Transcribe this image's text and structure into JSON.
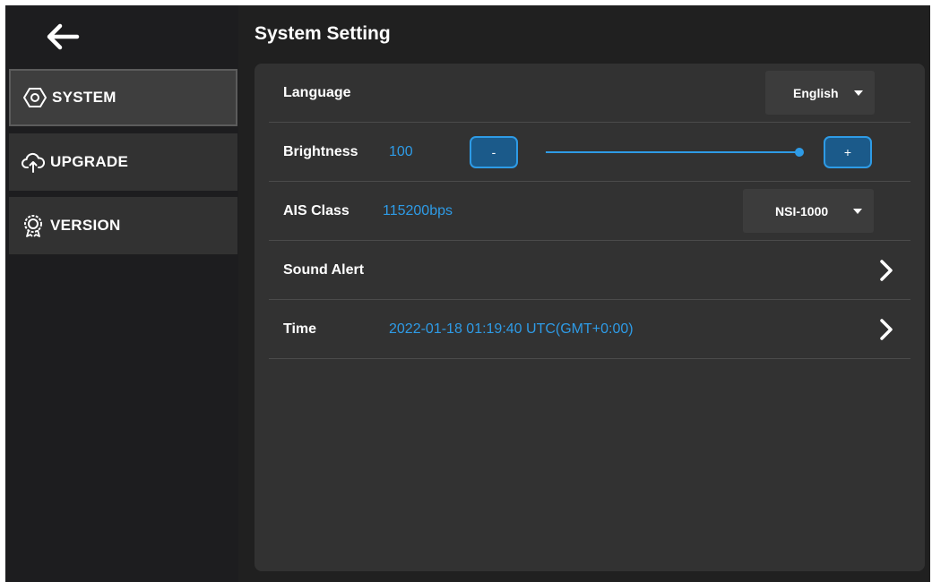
{
  "sidebar": {
    "items": [
      {
        "label": "SYSTEM",
        "icon": "hexagon-nut-icon",
        "active": true
      },
      {
        "label": "UPGRADE",
        "icon": "cloud-upload-icon",
        "active": false
      },
      {
        "label": "VERSION",
        "icon": "badge-ribbon-icon",
        "active": false
      }
    ]
  },
  "header": {
    "title": "System Setting",
    "back_icon": "back-arrow-icon"
  },
  "settings": {
    "language": {
      "label": "Language",
      "value": "English"
    },
    "brightness": {
      "label": "Brightness",
      "value": "100",
      "level": 1.0,
      "minus_label": "-",
      "plus_label": "+"
    },
    "ais_class": {
      "label": "AIS Class",
      "rate": "115200bps",
      "value": "NSI-1000"
    },
    "sound_alert": {
      "label": "Sound Alert"
    },
    "time": {
      "label": "Time",
      "value": "2022-01-18 01:19:40 UTC(GMT+0:00)"
    }
  },
  "colors": {
    "accent": "#2e9be6",
    "panel": "#323232",
    "background": "#202020"
  }
}
